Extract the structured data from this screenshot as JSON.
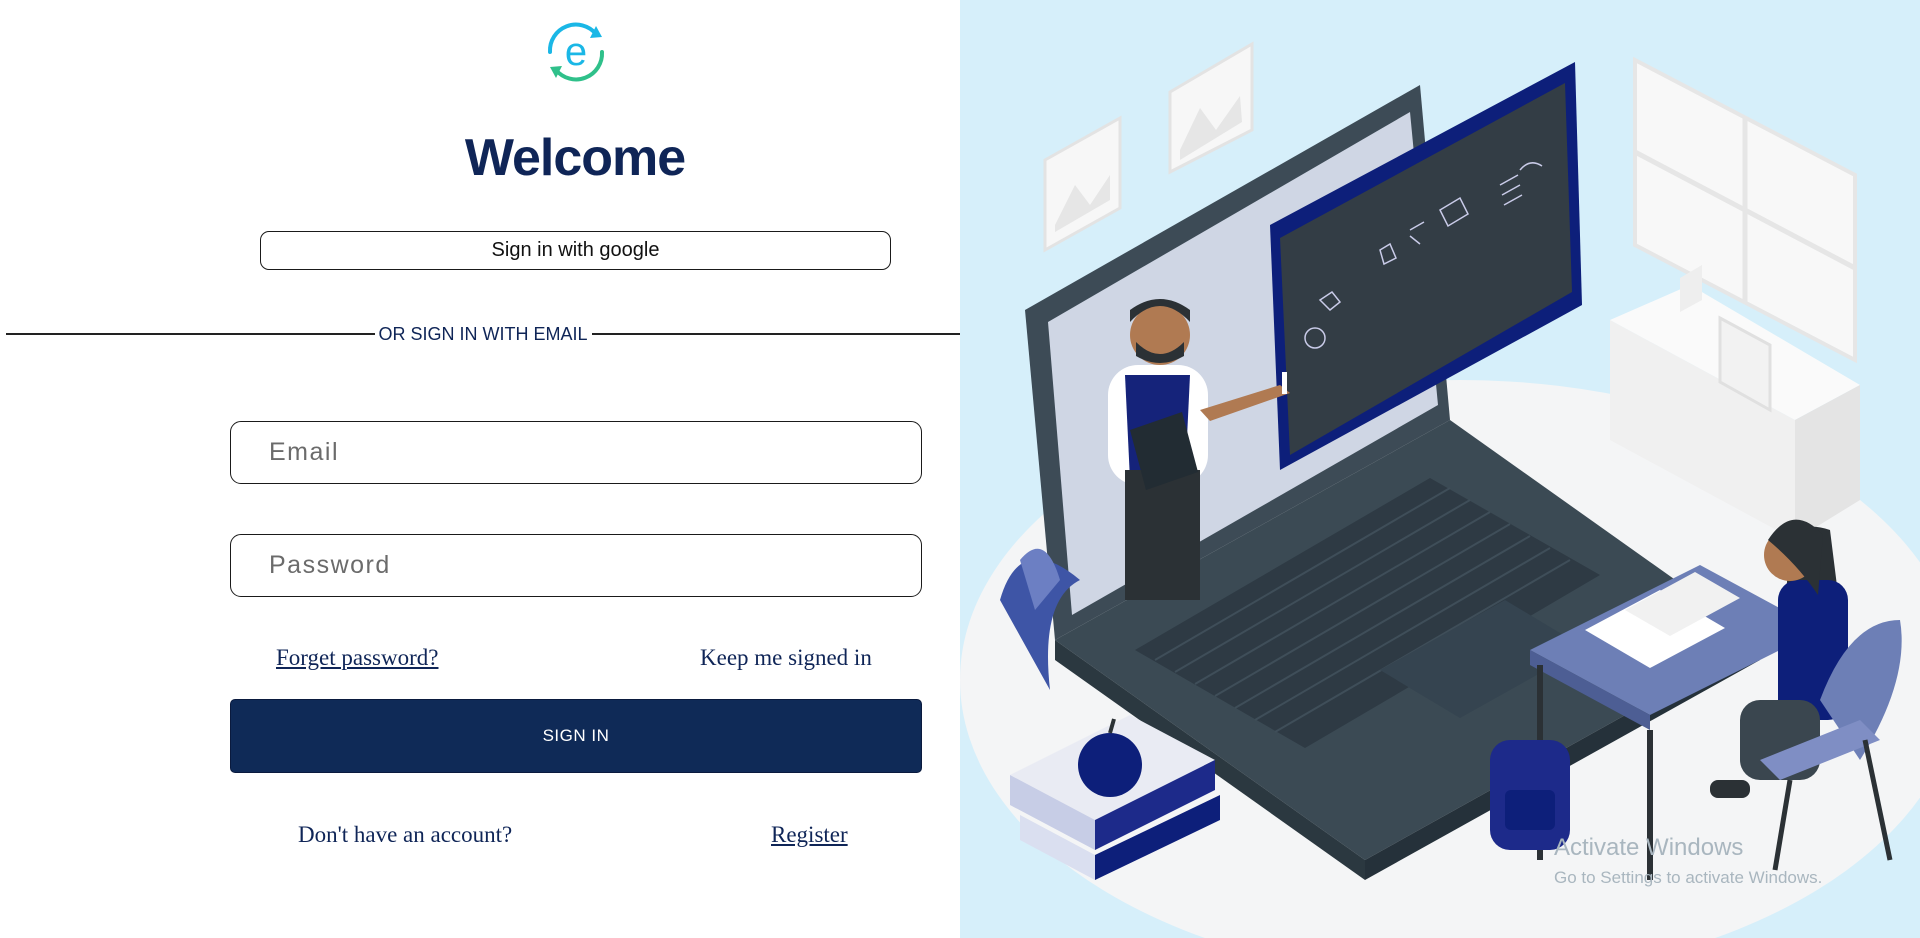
{
  "login": {
    "logo_icon": "e-refresh-logo-icon",
    "title": "Welcome",
    "google_button_label": "Sign in with google",
    "divider_label": "OR SIGN IN WITH EMAIL",
    "email_placeholder": "Email",
    "password_placeholder": "Password",
    "forget_password_label": "Forget password?",
    "keep_signed_in_label": "Keep me signed in",
    "sign_in_button_label": "SIGN IN",
    "no_account_text": "Don't have an account?",
    "register_label": "Register"
  },
  "illustration": {
    "description_icon": "online-class-teacher-laptop-illustration"
  },
  "watermark": {
    "title": "Activate Windows",
    "subtitle": "Go to Settings to activate Windows."
  },
  "colors": {
    "brand_navy": "#0f2a57",
    "panel_background": "#d6effa",
    "logo_cyan": "#1ab7e6",
    "logo_green": "#2fc08a"
  }
}
